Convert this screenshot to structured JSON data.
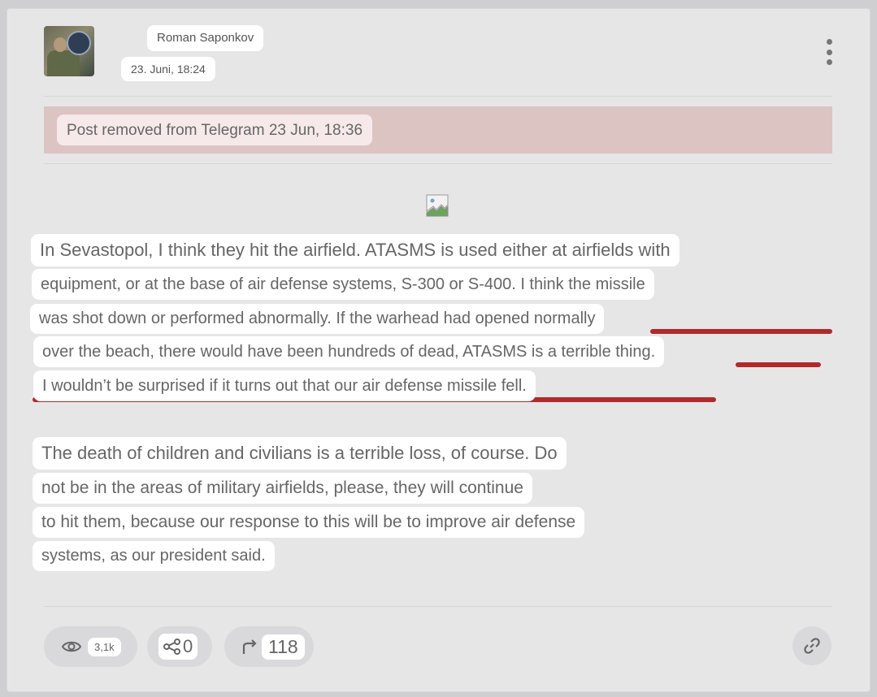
{
  "post": {
    "author": "Roman Saponkov",
    "date": "23. Juni, 18:24",
    "removed_notice": "Post removed from Telegram 23 Jun, 18:36",
    "paragraph1": [
      "In Sevastopol, I think they hit the airfield. ATASMS is used either at airfields with",
      "equipment, or at the base of air defense systems, S-300 or S-400. I think the missile",
      "was shot down or performed abnormally. If the warhead had opened normally",
      "over the beach, there would have been hundreds of dead, ATASMS is a terrible thing.",
      "I wouldn’t be surprised if it turns out that our air defense missile fell."
    ],
    "paragraph2": [
      "The death of children and civilians is a terrible loss, of course. Do",
      "not be in the areas of military airfields, please, they will continue",
      "to hit them, because our response to this will be to improve air defense",
      "systems, as our president said."
    ]
  },
  "footer": {
    "views": "3,1k",
    "shares": "0",
    "forwards": "118"
  },
  "icons": {
    "menu": "more-vertical-icon",
    "views": "eye-icon",
    "shares": "share-icon",
    "forwards": "forward-arrow-icon",
    "link": "link-icon",
    "image": "broken-image-icon"
  },
  "colors": {
    "card_bg": "#e6e6e7",
    "removed_banner": "#dcc4c3",
    "underline": "#b02a2a"
  }
}
